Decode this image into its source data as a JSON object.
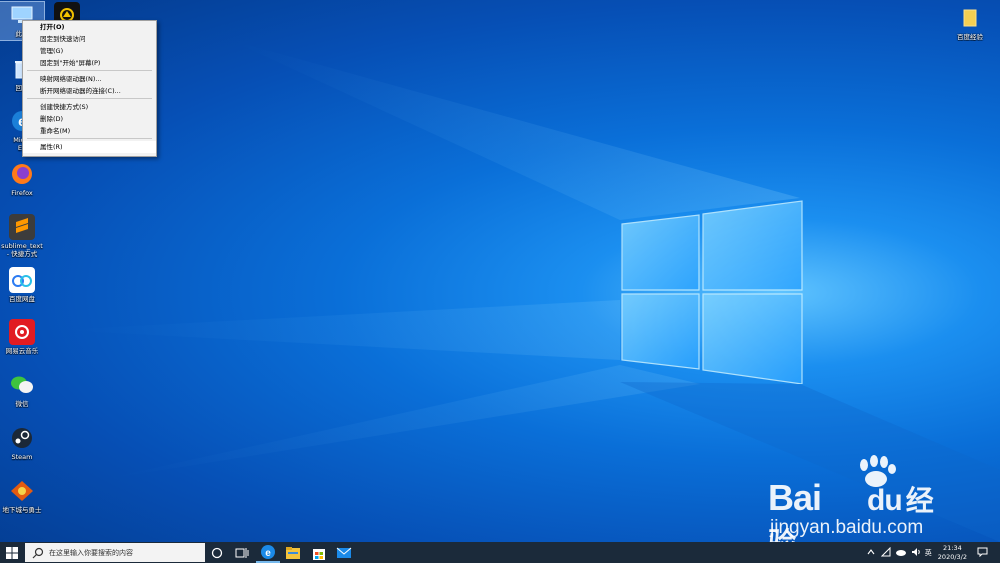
{
  "desktop": {
    "icons_left": [
      {
        "name": "this-pc",
        "label": "此电",
        "icon": "computer-icon"
      },
      {
        "name": "recycle-bin",
        "label": "回收",
        "icon": "recycle-bin-icon"
      },
      {
        "name": "edge",
        "label": "Micro",
        "label2": "Ed",
        "icon": "edge-icon"
      },
      {
        "name": "firefox",
        "label": "Firefox",
        "icon": "firefox-icon"
      },
      {
        "name": "sublime",
        "label": "sublime_text",
        "label2": "- 快捷方式",
        "icon": "sublime-icon"
      },
      {
        "name": "baidu-netdisk",
        "label": "百度网盘",
        "icon": "baidu-netdisk-icon"
      },
      {
        "name": "netease-music",
        "label": "网易云音乐",
        "icon": "netease-music-icon"
      },
      {
        "name": "wechat",
        "label": "微信",
        "icon": "wechat-icon"
      },
      {
        "name": "steam",
        "label": "Steam",
        "icon": "steam-icon"
      },
      {
        "name": "game",
        "label": "地下城与勇士",
        "icon": "game-icon"
      }
    ],
    "icon_top_right": {
      "label": "百度经验",
      "icon": "folder-icon"
    }
  },
  "context_menu": {
    "items": [
      {
        "label": "打开(O)",
        "bold": true
      },
      {
        "label": "固定到快速访问"
      },
      {
        "label": "管理(G)"
      },
      {
        "label": "固定到\"开始\"屏幕(P)"
      },
      {
        "sep": true
      },
      {
        "label": "映射网络驱动器(N)..."
      },
      {
        "label": "断开网络驱动器的连接(C)..."
      },
      {
        "sep": true
      },
      {
        "label": "创建快捷方式(S)"
      },
      {
        "label": "删除(D)"
      },
      {
        "label": "重命名(M)"
      },
      {
        "sep": true
      },
      {
        "label": "属性(R)",
        "highlight": true
      }
    ]
  },
  "watermark": {
    "brand": "Bai",
    "brand2": "du",
    "cn": "经验",
    "url": "jingyan.baidu.com"
  },
  "taskbar": {
    "search_placeholder": "在这里输入你要搜索的内容",
    "tray": {
      "ime": "英",
      "time": "21:34",
      "date": "2020/3/2"
    }
  },
  "colors": {
    "accent": "#0a6fd8",
    "taskbar": "#1b2a3a"
  }
}
